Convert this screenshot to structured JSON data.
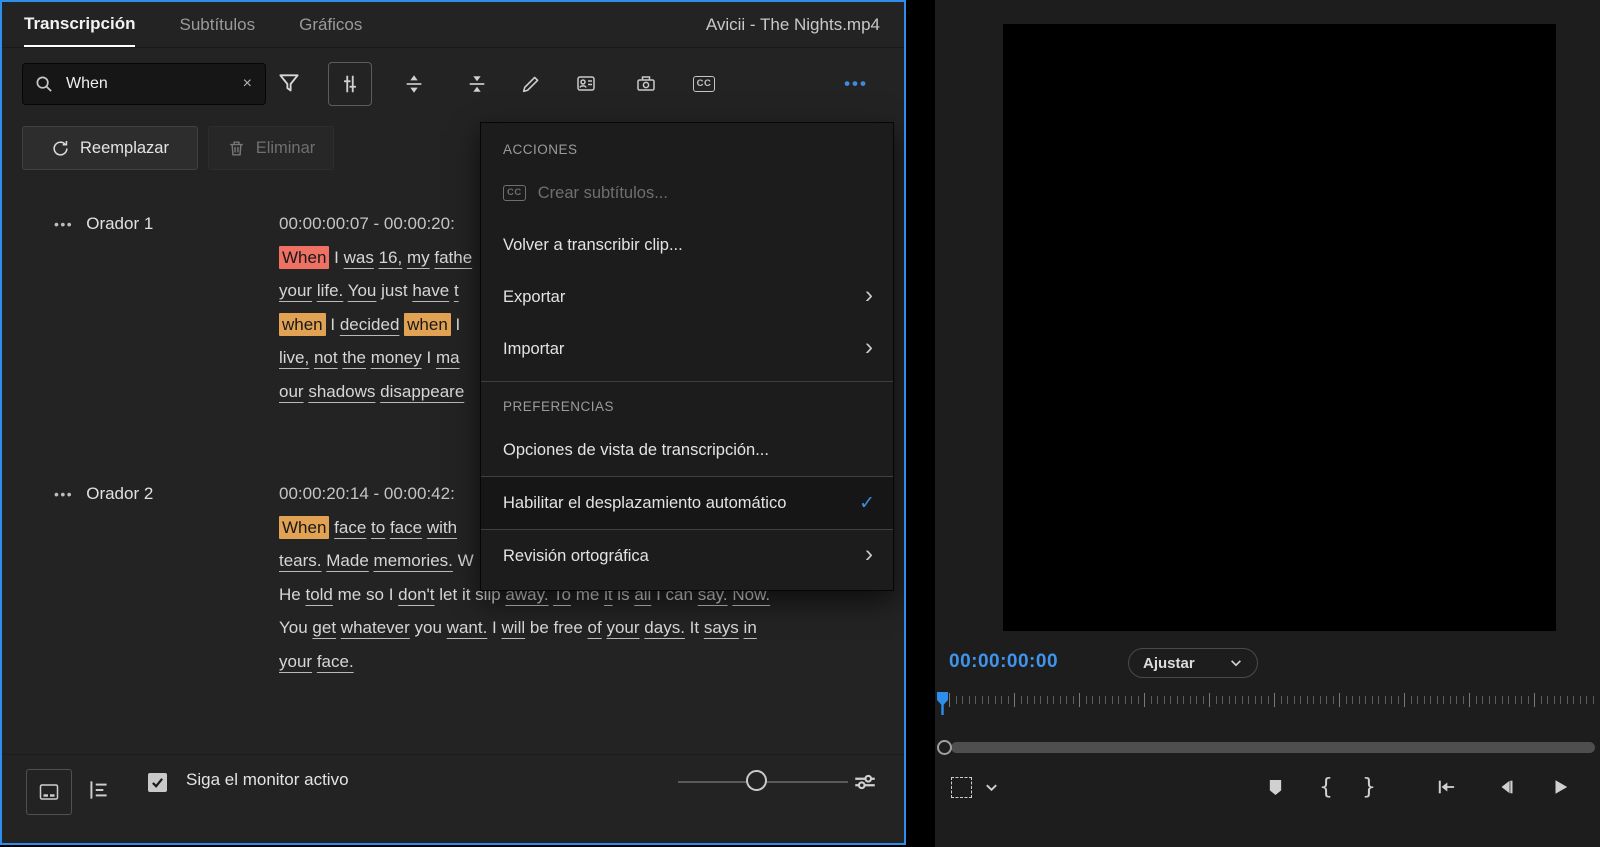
{
  "colors": {
    "accent": "#2f8deb",
    "highlight_current": "#ef7164",
    "highlight_match": "#e2a254",
    "timecode_blue": "#3f94ee",
    "check_blue": "#3f8ae0"
  },
  "tabs": {
    "transcription": "Transcripción",
    "subtitles": "Subtítulos",
    "graphics": "Gráficos"
  },
  "clip_title": "Avicii - The Nights.mp4",
  "search": {
    "value": "When",
    "clear_glyph": "×"
  },
  "toolbar": {
    "more_glyph": "•••",
    "cc_label": "CC"
  },
  "actions": {
    "replace": "Reemplazar",
    "delete": "Eliminar"
  },
  "transcript": {
    "speakers": [
      {
        "name": "Orador 1",
        "handle": "•••",
        "timecode": "00:00:00:07 - 00:00:20:",
        "lines": [
          [
            {
              "t": "When",
              "hl": "current"
            },
            {
              "t": "I"
            },
            {
              "t": "was",
              "u": 1
            },
            {
              "t": "16,",
              "u": 1
            },
            {
              "t": "my",
              "u": 1
            },
            {
              "t": "fathe",
              "u": 1
            }
          ],
          [
            {
              "t": "your",
              "u": 1
            },
            {
              "t": "life.",
              "u": 1
            },
            {
              "t": "You",
              "u": 1
            },
            {
              "t": "just"
            },
            {
              "t": "have",
              "u": 1
            },
            {
              "t": "t",
              "u": 1
            }
          ],
          [
            {
              "t": "when",
              "hl": "match"
            },
            {
              "t": "I"
            },
            {
              "t": "decided",
              "u": 1
            },
            {
              "t": "when",
              "hl": "match"
            },
            {
              "t": "I"
            }
          ],
          [
            {
              "t": "live,",
              "u": 1
            },
            {
              "t": "not",
              "u": 1
            },
            {
              "t": "the",
              "u": 1
            },
            {
              "t": "money",
              "u": 1
            },
            {
              "t": "I"
            },
            {
              "t": "ma",
              "u": 1
            }
          ],
          [
            {
              "t": "our",
              "u": 1
            },
            {
              "t": "shadows",
              "u": 1
            },
            {
              "t": "disappeare",
              "u": 1
            }
          ]
        ]
      },
      {
        "name": "Orador 2",
        "handle": "•••",
        "timecode": "00:00:20:14 - 00:00:42:",
        "lines": [
          [
            {
              "t": "When",
              "hl": "match"
            },
            {
              "t": "face",
              "u": 1
            },
            {
              "t": "to",
              "u": 1
            },
            {
              "t": "face",
              "u": 1
            },
            {
              "t": "with",
              "u": 1
            }
          ],
          [
            {
              "t": "tears.",
              "u": 1
            },
            {
              "t": "Made",
              "u": 1
            },
            {
              "t": "memories.",
              "u": 1
            },
            {
              "t": "W"
            }
          ],
          [
            {
              "t": "He"
            },
            {
              "t": "told",
              "u": 1
            },
            {
              "t": "me"
            },
            {
              "t": "so"
            },
            {
              "t": "I"
            },
            {
              "t": "don't",
              "u": 1
            },
            {
              "t": "let"
            },
            {
              "t": "it"
            },
            {
              "t": "slip"
            },
            {
              "t": "away.",
              "u": 1
            },
            {
              "t": "To",
              "u": 1
            },
            {
              "t": "me"
            },
            {
              "t": "it",
              "u": 1
            },
            {
              "t": "is"
            },
            {
              "t": "all",
              "u": 1
            },
            {
              "t": "I"
            },
            {
              "t": "can"
            },
            {
              "t": "say.",
              "u": 1
            },
            {
              "t": "Now.",
              "u": 1
            }
          ],
          [
            {
              "t": "You"
            },
            {
              "t": "get",
              "u": 1
            },
            {
              "t": "whatever",
              "u": 1
            },
            {
              "t": "you"
            },
            {
              "t": "want.",
              "u": 1
            },
            {
              "t": "I"
            },
            {
              "t": "will",
              "u": 1
            },
            {
              "t": "be"
            },
            {
              "t": "free"
            },
            {
              "t": "of",
              "u": 1
            },
            {
              "t": "your",
              "u": 1
            },
            {
              "t": "days.",
              "u": 1
            },
            {
              "t": "It"
            },
            {
              "t": "says",
              "u": 1
            },
            {
              "t": "in",
              "u": 1
            }
          ],
          [
            {
              "t": "your",
              "u": 1
            },
            {
              "t": "face.",
              "u": 1
            }
          ]
        ]
      }
    ]
  },
  "menu": {
    "sections": [
      {
        "header": "ACCIONES",
        "items": [
          {
            "label": "Crear subtítulos...",
            "icon": "cc",
            "disabled": true
          },
          {
            "label": "Volver a transcribir clip..."
          },
          {
            "label": "Exportar",
            "submenu": true
          },
          {
            "label": "Importar",
            "submenu": true,
            "divider_after": true
          }
        ]
      },
      {
        "header": "PREFERENCIAS",
        "items": [
          {
            "label": "Opciones de vista de transcripción..."
          },
          {
            "label": "Habilitar el desplazamiento automático",
            "checked": true,
            "selected": true
          },
          {
            "label": "Revisión ortográfica",
            "submenu": true
          }
        ]
      }
    ]
  },
  "footer": {
    "follow_monitor": "Siga el monitor activo",
    "checked": true
  },
  "monitor": {
    "timecode": "00:00:00:00",
    "zoom_select": "Ajustar"
  }
}
